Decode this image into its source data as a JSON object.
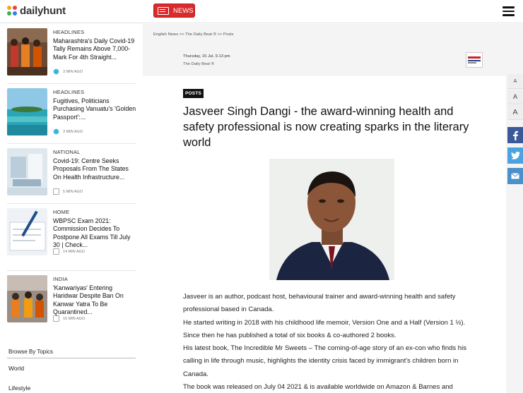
{
  "header": {
    "logo_text": "dailyhunt",
    "news_label": "NEWS",
    "brand_color": "#d92b2b"
  },
  "sidebar": {
    "cards": [
      {
        "category": "HEADLINES",
        "title": "Maharashtra's Daily Covid-19 Tally Remains Above 7,000-Mark For 4th Straight...",
        "time": "3 MIN AGO"
      },
      {
        "category": "HEADLINES",
        "title": "Fugitives, Politicians Purchasing Vanuatu's 'Golden Passport':...",
        "time": "3 MIN AGO"
      },
      {
        "category": "NATIONAL",
        "title": "Covid-19: Centre Seeks Proposals From The States On Health Infrastructure...",
        "time": "5 MIN AGO"
      },
      {
        "category": "HOME",
        "title": "WBPSC Exam 2021: Commission Decides To Postpone All Exams Till July 30 | Check...",
        "time": "14 MIN AGO"
      },
      {
        "category": "INDIA",
        "title": "'Kanwariyas' Entering Haridwar Despite Ban On Kanwar Yatra To Be Quarantined...",
        "time": "15 MIN AGO"
      }
    ],
    "topics_title": "Browse By Topics",
    "topics": [
      "World",
      "Lifestyle"
    ]
  },
  "article": {
    "breadcrumb": "English News >> The Daily Beat ® >> Posts",
    "date": "Thursday, 15 Jul, 9.13 pm",
    "source": "The Daily Beat ®",
    "badge": "POSTS",
    "headline": "Jasveer Singh Dangi - the award-winning health and safety professional is now creating sparks in the literary world",
    "paragraphs": [
      "Jasveer is an author, podcast host, behavioural trainer and award-winning health and safety professional based in Canada.",
      "He started writing in 2018 with his childhood life memoir, Version One and a Half (Version 1 ½). Since then he has published a total of six books & co-authored 2 books.",
      "His latest book, The Incredible Mr Sweets – The coming-of-age story of an ex-con who finds his calling in life through music, highlights the identity crisis faced by immigrant's children born in Canada.",
      "The book was released on July 04 2021 & is available worldwide on Amazon & Barnes and"
    ]
  },
  "tools": {
    "font_sizes": [
      "A",
      "A",
      "A"
    ],
    "share": [
      "facebook-icon",
      "twitter-icon",
      "email-icon"
    ]
  }
}
